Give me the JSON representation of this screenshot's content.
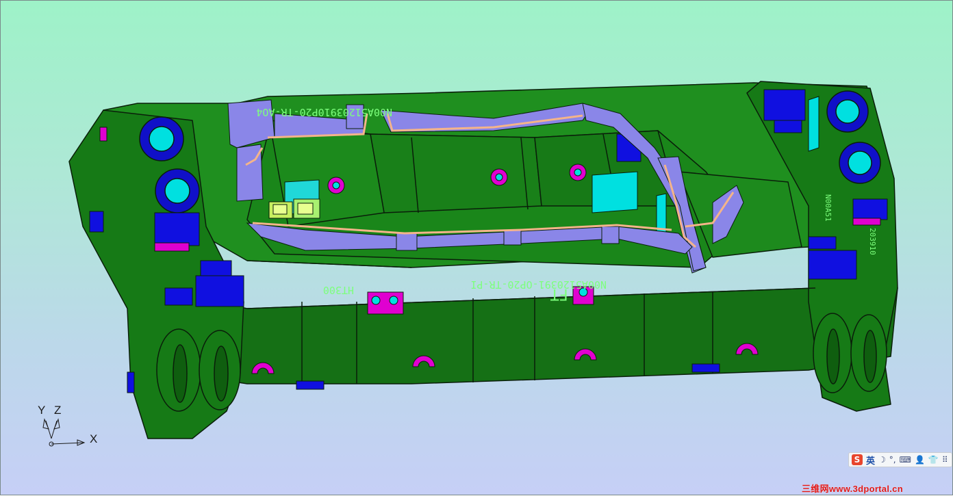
{
  "viewport": {
    "background_top": "#9ef2c8",
    "background_bottom": "#c6cff6"
  },
  "model": {
    "base_color": "#167a16",
    "edge_color": "#0a1e0a",
    "engravings": {
      "top_back": "N00A51203910P20-TR-AO4",
      "front_part_number": "N00A5120391-OP20-TR-PI",
      "front_code": "HT300",
      "front_logo": "FT",
      "right_side_1": "N00A51",
      "right_side_2": "203910"
    },
    "colors": {
      "pads": "#1010e0",
      "bores": "#00e0e0",
      "holes": "#e000d0",
      "rails": "#8a86e8",
      "trim": "#f4b48a",
      "light": "#a8f070"
    }
  },
  "triad": {
    "y_label": "Y",
    "z_label": "Z",
    "x_label": "X"
  },
  "ime": {
    "logo": "S",
    "lang": "英",
    "moon": "☽",
    "dot": "°,",
    "keyboard": "⌨",
    "user": "👤",
    "shirt": "👕",
    "grid": "⠿"
  },
  "watermark": "三维网www.3dportal.cn"
}
